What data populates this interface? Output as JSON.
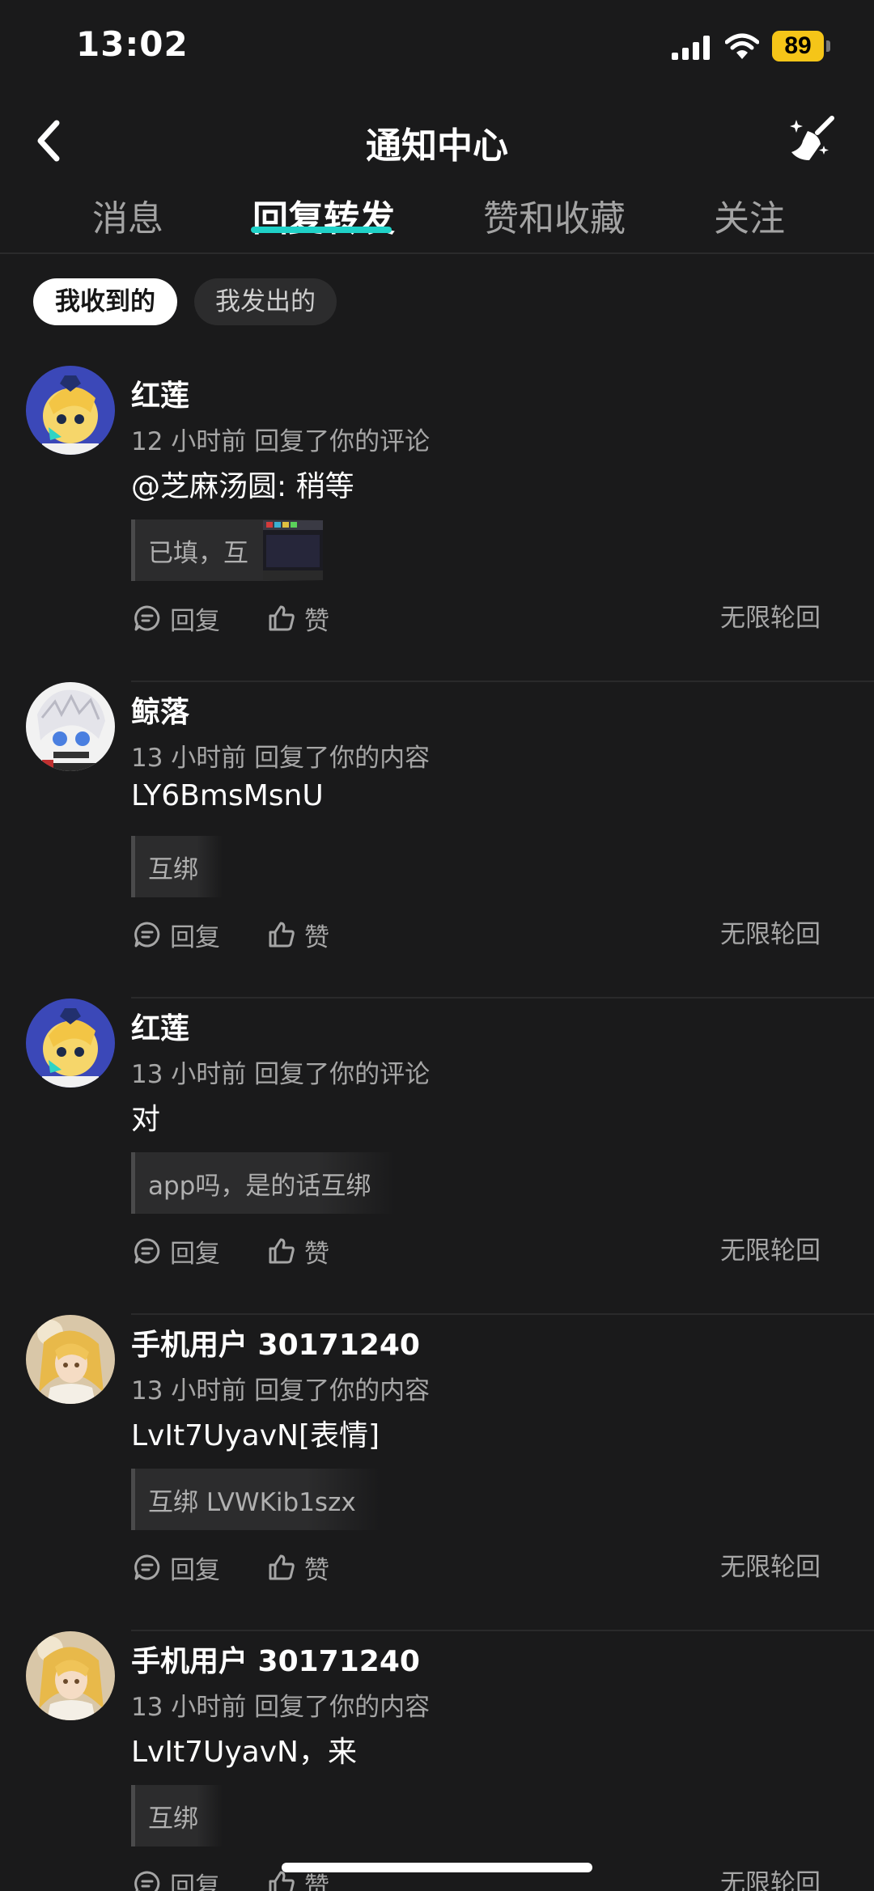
{
  "status_bar": {
    "time": "13:02",
    "battery": "89"
  },
  "header": {
    "title": "通知中心"
  },
  "tabs": [
    {
      "label": "消息"
    },
    {
      "label": "回复转发"
    },
    {
      "label": "赞和收藏"
    },
    {
      "label": "关注"
    }
  ],
  "filters": {
    "received": "我收到的",
    "sent": "我发出的"
  },
  "notifications": [
    {
      "username": "红莲",
      "meta": "12 小时前 回复了你的评论",
      "content": "@芝麻汤圆: 稍等",
      "quote": "已填，互",
      "reply_label": "回复",
      "like_label": "赞",
      "source": "无限轮回"
    },
    {
      "username": "鲸落",
      "meta": "13 小时前 回复了你的内容",
      "content": "LY6BmsMsnU",
      "quote": "互绑",
      "reply_label": "回复",
      "like_label": "赞",
      "source": "无限轮回"
    },
    {
      "username": "红莲",
      "meta": "13 小时前 回复了你的评论",
      "content": "对",
      "quote": "app吗，是的话互绑",
      "reply_label": "回复",
      "like_label": "赞",
      "source": "无限轮回"
    },
    {
      "username": "手机用户 30171240",
      "meta": "13 小时前 回复了你的内容",
      "content": "LvIt7UyavN[表情]",
      "quote": "互绑 LVWKib1szx",
      "reply_label": "回复",
      "like_label": "赞",
      "source": "无限轮回"
    },
    {
      "username": "手机用户 30171240",
      "meta": "13 小时前 回复了你的内容",
      "content": "LvIt7UyavN，来",
      "quote": "互绑",
      "reply_label": "回复",
      "like_label": "赞",
      "source": "无限轮回"
    }
  ],
  "colors": {
    "background": "#1a1a1b",
    "accent": "#1fd1c7",
    "battery": "#f5c518"
  }
}
